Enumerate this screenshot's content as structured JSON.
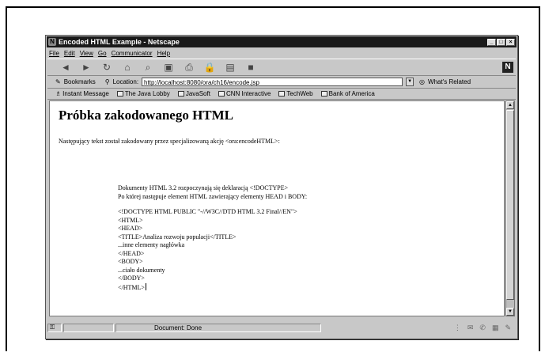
{
  "window": {
    "title": "Encoded HTML Example - Netscape"
  },
  "menu": {
    "items": [
      "File",
      "Edit",
      "View",
      "Go",
      "Communicator",
      "Help"
    ]
  },
  "location": {
    "bookmarks_label": "Bookmarks",
    "location_label": "Location:",
    "url": "http://localhost:8080/ora/ch16/encode.jsp",
    "related_label": "What's Related"
  },
  "links": {
    "items": [
      "Instant Message",
      "The Java Lobby",
      "JavaSoft",
      "CNN Interactive",
      "TechWeb",
      "Bank of America"
    ]
  },
  "page": {
    "title": "Próbka zakodowanego HTML",
    "intro": "Następujący tekst został zakodowany przez specjalizowaną akcję <ora:encodeHTML>:",
    "block1": [
      "Dokumenty HTML 3.2 rozpoczynają się deklaracją <!DOCTYPE>",
      "Po której następuje element HTML zawierający elementy HEAD i BODY:"
    ],
    "block2": [
      "<!DOCTYPE HTML PUBLIC \"-//W3C//DTD HTML 3.2 Final//EN\">",
      "<HTML>",
      "<HEAD>",
      "<TITLE>Analiza rozwoju populacji</TITLE>",
      "...inne elementy nagłówka",
      "</HEAD>",
      "<BODY>",
      "...ciało dokumenty",
      "</BODY>",
      "</HTML>"
    ]
  },
  "status": {
    "text": "Document: Done"
  }
}
